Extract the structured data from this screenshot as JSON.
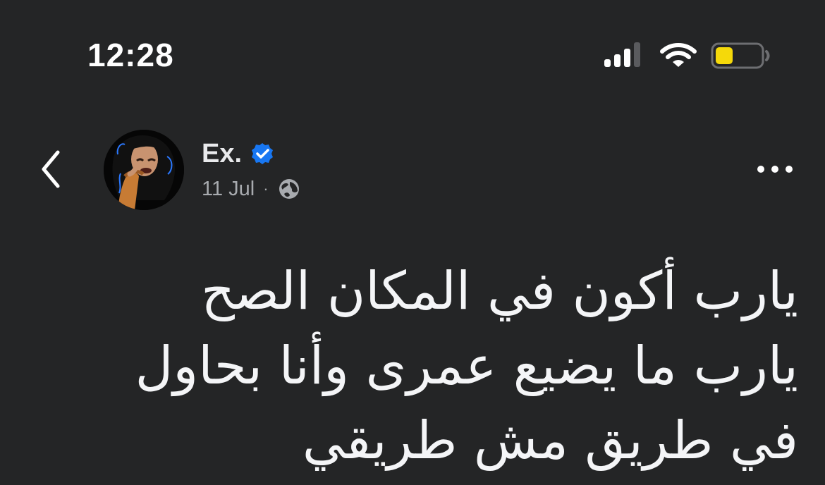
{
  "status_bar": {
    "time": "12:28",
    "signal_icon": "cellular-signal-icon",
    "wifi_icon": "wifi-icon",
    "battery_icon": "battery-icon",
    "battery_color": "#f5d90a",
    "battery_level": 0.38
  },
  "post": {
    "author_name": "Ex.",
    "verified": true,
    "verified_color": "#1877f2",
    "date": "11 Jul",
    "separator": "·",
    "audience_icon": "globe-icon",
    "lines": [
      "يارب أكون في المكان الصح",
      "يارب ما يضيع عمرى وأنا بحاول",
      "في طريق مش طريقي"
    ]
  },
  "navigation": {
    "back_icon": "chevron-left-icon",
    "more_icon": "more-horizontal-icon"
  }
}
